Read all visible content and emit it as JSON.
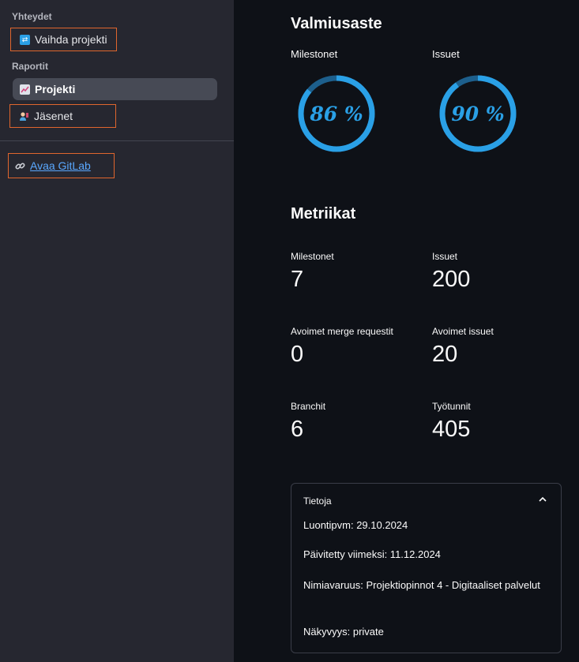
{
  "sidebar": {
    "heading_connections": "Yhteydet",
    "switch_project": "Vaihda projekti",
    "heading_reports": "Raportit",
    "project": "Projekti",
    "members": "Jäsenet",
    "open_gitlab": "Avaa GitLab",
    "icons": [
      "swap-icon",
      "chart-icon",
      "person-icon",
      "link-icon"
    ]
  },
  "readiness": {
    "title": "Valmiusaste",
    "milestones_label": "Milestonet",
    "milestones_value": "86 %",
    "milestones_percent": 86,
    "issues_label": "Issuet",
    "issues_value": "90 %",
    "issues_percent": 90
  },
  "metrics": {
    "title": "Metriikat",
    "items": [
      {
        "label": "Milestonet",
        "value": "7"
      },
      {
        "label": "Issuet",
        "value": "200"
      },
      {
        "label": "Avoimet merge requestit",
        "value": "0"
      },
      {
        "label": "Avoimet issuet",
        "value": "20"
      },
      {
        "label": "Branchit",
        "value": "6"
      },
      {
        "label": "Työtunnit",
        "value": "405"
      }
    ]
  },
  "info": {
    "title": "Tietoja",
    "created": "Luontipvm: 29.10.2024",
    "updated": "Päivitetty viimeksi: 11.12.2024",
    "namespace": "Nimiavaruus: Projektiopinnot 4 - Digitaaliset palvelut",
    "visibility": "Näkyvyys: private"
  },
  "colors": {
    "accent": "#2aa0e6",
    "outline": "#e0662d",
    "gauge_track": "#1d5f8c"
  }
}
